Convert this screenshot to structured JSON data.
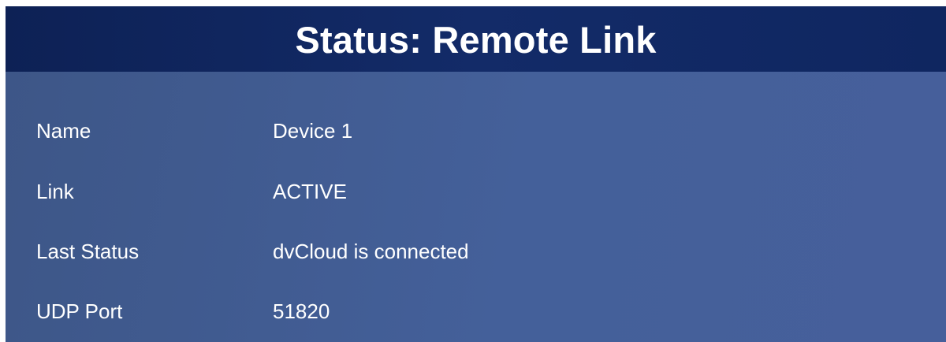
{
  "header": {
    "title": "Status: Remote Link"
  },
  "rows": [
    {
      "label": "Name",
      "value": "Device 1"
    },
    {
      "label": "Link",
      "value": "ACTIVE"
    },
    {
      "label": "Last Status",
      "value": "dvCloud is connected"
    },
    {
      "label": "UDP Port",
      "value": "51820"
    }
  ],
  "colors": {
    "header_bg": "#132b68",
    "panel_bg": "#44609a",
    "text": "#ffffff"
  }
}
